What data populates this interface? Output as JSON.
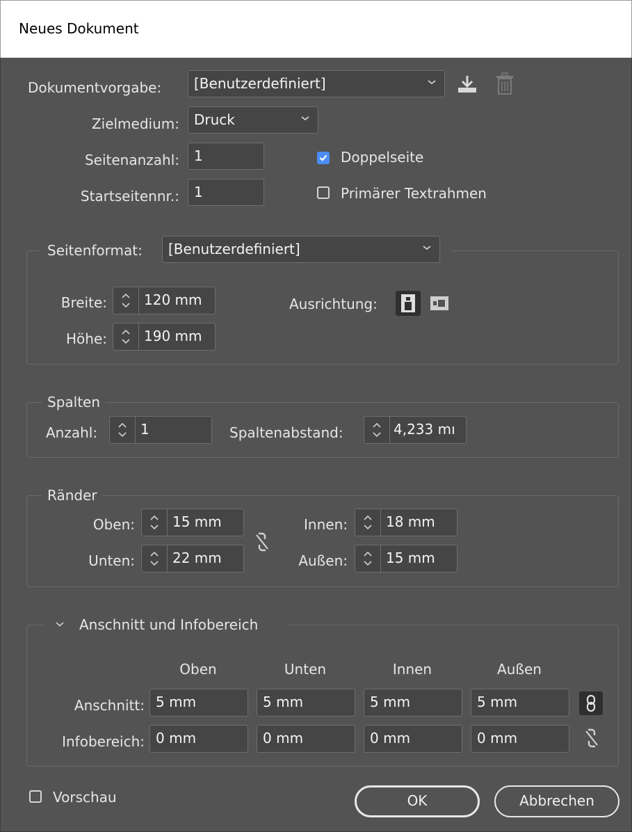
{
  "window": {
    "title": "Neues Dokument"
  },
  "preset": {
    "label": "Dokumentvorgabe:",
    "value": "[Benutzerdefiniert]",
    "save_icon": "download-icon",
    "delete_icon": "trash-icon"
  },
  "intent": {
    "label": "Zielmedium:",
    "value": "Druck"
  },
  "pages": {
    "label": "Seitenanzahl:",
    "value": "1"
  },
  "start_page": {
    "label": "Startseitennr.:",
    "value": "1"
  },
  "facing_pages": {
    "label": "Doppelseite",
    "checked": true
  },
  "primary_frame": {
    "label": "Primärer Textrahmen",
    "checked": false
  },
  "page_size": {
    "label": "Seitenformat:",
    "value": "[Benutzerdefiniert]",
    "width_label": "Breite:",
    "width_value": "120 mm",
    "height_label": "Höhe:",
    "height_value": "190 mm",
    "orientation_label": "Ausrichtung:"
  },
  "columns": {
    "legend": "Spalten",
    "count_label": "Anzahl:",
    "count_value": "1",
    "gutter_label": "Spaltenabstand:",
    "gutter_value": "4,233 mı"
  },
  "margins": {
    "legend": "Ränder",
    "top_label": "Oben:",
    "top_value": "15 mm",
    "bottom_label": "Unten:",
    "bottom_value": "22 mm",
    "inside_label": "Innen:",
    "inside_value": "18 mm",
    "outside_label": "Außen:",
    "outside_value": "15 mm"
  },
  "bleed_slug": {
    "legend": "Anschnitt und Infobereich",
    "headers": [
      "Oben",
      "Unten",
      "Innen",
      "Außen"
    ],
    "bleed_label": "Anschnitt:",
    "bleed_values": [
      "5 mm",
      "5 mm",
      "5 mm",
      "5 mm"
    ],
    "slug_label": "Infobereich:",
    "slug_values": [
      "0 mm",
      "0 mm",
      "0 mm",
      "0 mm"
    ]
  },
  "preview": {
    "label": "Vorschau",
    "checked": false
  },
  "buttons": {
    "ok": "OK",
    "cancel": "Abbrechen"
  },
  "colors": {
    "accent": "#4c8df6",
    "dialog_bg": "#535353",
    "field_bg": "#454545"
  }
}
